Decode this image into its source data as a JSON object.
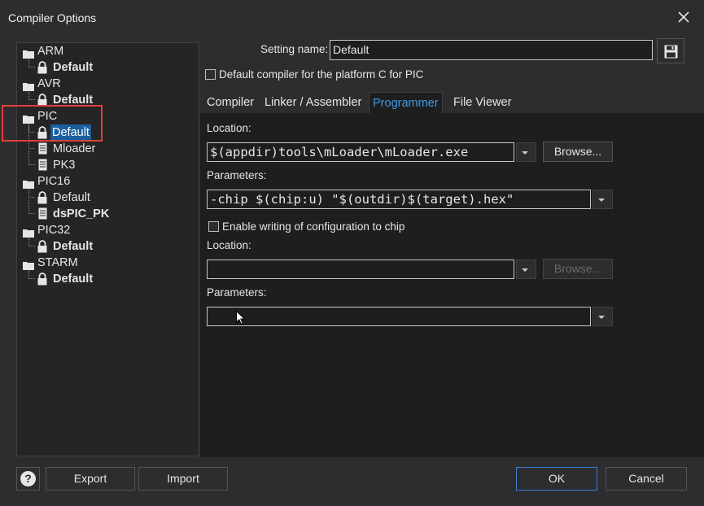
{
  "window": {
    "title": "Compiler Options"
  },
  "tree": {
    "groups": [
      {
        "name": "ARM",
        "children": [
          {
            "label": "Default",
            "bold": true,
            "icon": "lock-icon"
          }
        ]
      },
      {
        "name": "AVR",
        "children": [
          {
            "label": "Default",
            "bold": true,
            "icon": "lock-icon"
          }
        ]
      },
      {
        "name": "PIC",
        "children": [
          {
            "label": "Default",
            "bold": false,
            "icon": "lock-icon",
            "selected": true
          },
          {
            "label": "Mloader",
            "bold": false,
            "icon": "file-icon"
          },
          {
            "label": "PK3",
            "bold": false,
            "icon": "file-icon"
          }
        ]
      },
      {
        "name": "PIC16",
        "children": [
          {
            "label": "Default",
            "bold": false,
            "icon": "lock-icon"
          },
          {
            "label": "dsPIC_PK",
            "bold": true,
            "icon": "file-icon"
          }
        ]
      },
      {
        "name": "PIC32",
        "children": [
          {
            "label": "Default",
            "bold": true,
            "icon": "lock-icon"
          }
        ]
      },
      {
        "name": "STARM",
        "children": [
          {
            "label": "Default",
            "bold": true,
            "icon": "lock-icon"
          }
        ]
      }
    ]
  },
  "setting": {
    "label": "Setting name:",
    "value": "Default"
  },
  "default_compiler": {
    "label": "Default compiler for the platform C for PIC",
    "checked": false
  },
  "tabs": [
    {
      "label": "Compiler",
      "active": false
    },
    {
      "label": "Linker / Assembler",
      "active": false
    },
    {
      "label": "Programmer",
      "active": true
    },
    {
      "label": "File Viewer",
      "active": false
    }
  ],
  "programmer": {
    "location_label": "Location:",
    "location_value": "$(appdir)tools\\mLoader\\mLoader.exe",
    "browse_label": "Browse...",
    "parameters_label": "Parameters:",
    "parameters_value": "-chip $(chip:u) \"$(outdir)$(target).hex\""
  },
  "config_writing": {
    "enable_label": "Enable writing of configuration to chip",
    "checked": false,
    "location_label": "Location:",
    "location_value": "",
    "browse_label": "Browse...",
    "parameters_label": "Parameters:",
    "parameters_value": ""
  },
  "footer": {
    "help_glyph": "?",
    "export_label": "Export",
    "import_label": "Import",
    "ok_label": "OK",
    "cancel_label": "Cancel"
  },
  "colors": {
    "background": "#2d2d30",
    "accent": "#3d9ae8",
    "selection": "#1a5f9e",
    "highlight_box": "#e0403a"
  }
}
